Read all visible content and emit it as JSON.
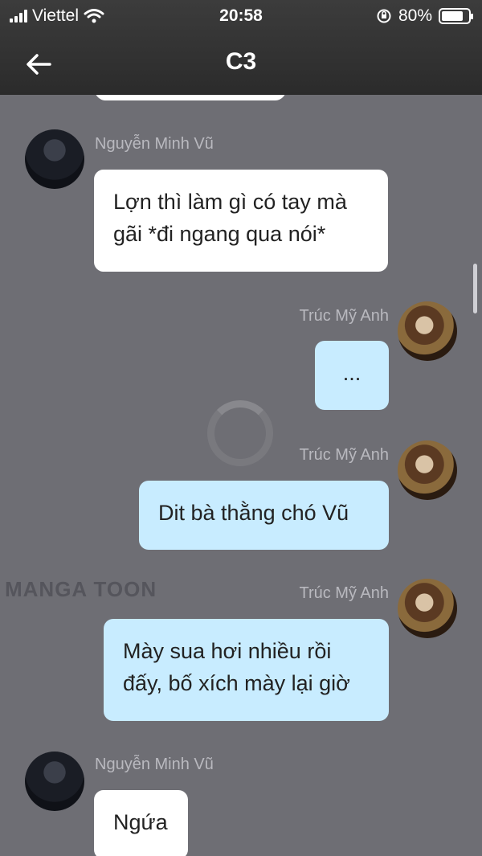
{
  "status_bar": {
    "carrier": "Viettel",
    "time": "20:58",
    "battery": "80%",
    "battery_level": 0.8
  },
  "header": {
    "title": "C3",
    "back_icon": "arrow-left-icon"
  },
  "watermark": "MANGA TOON",
  "messages": [
    {
      "sender": "Nguyễn Minh Vũ",
      "side": "left",
      "text": "Lợn thì làm gì có tay mà\ngãi *đi ngang qua nói*"
    },
    {
      "sender": "Trúc Mỹ Anh",
      "side": "right",
      "text": "..."
    },
    {
      "sender": "Trúc Mỹ Anh",
      "side": "right",
      "text": "Dit bà thằng chó Vũ"
    },
    {
      "sender": "Trúc Mỹ Anh",
      "side": "right",
      "text": "Mày sua hơi nhiều rồi\nđấy, bố xích mày lại giờ"
    },
    {
      "sender": "Nguyễn Minh Vũ",
      "side": "left",
      "text": "Ngứa"
    }
  ]
}
